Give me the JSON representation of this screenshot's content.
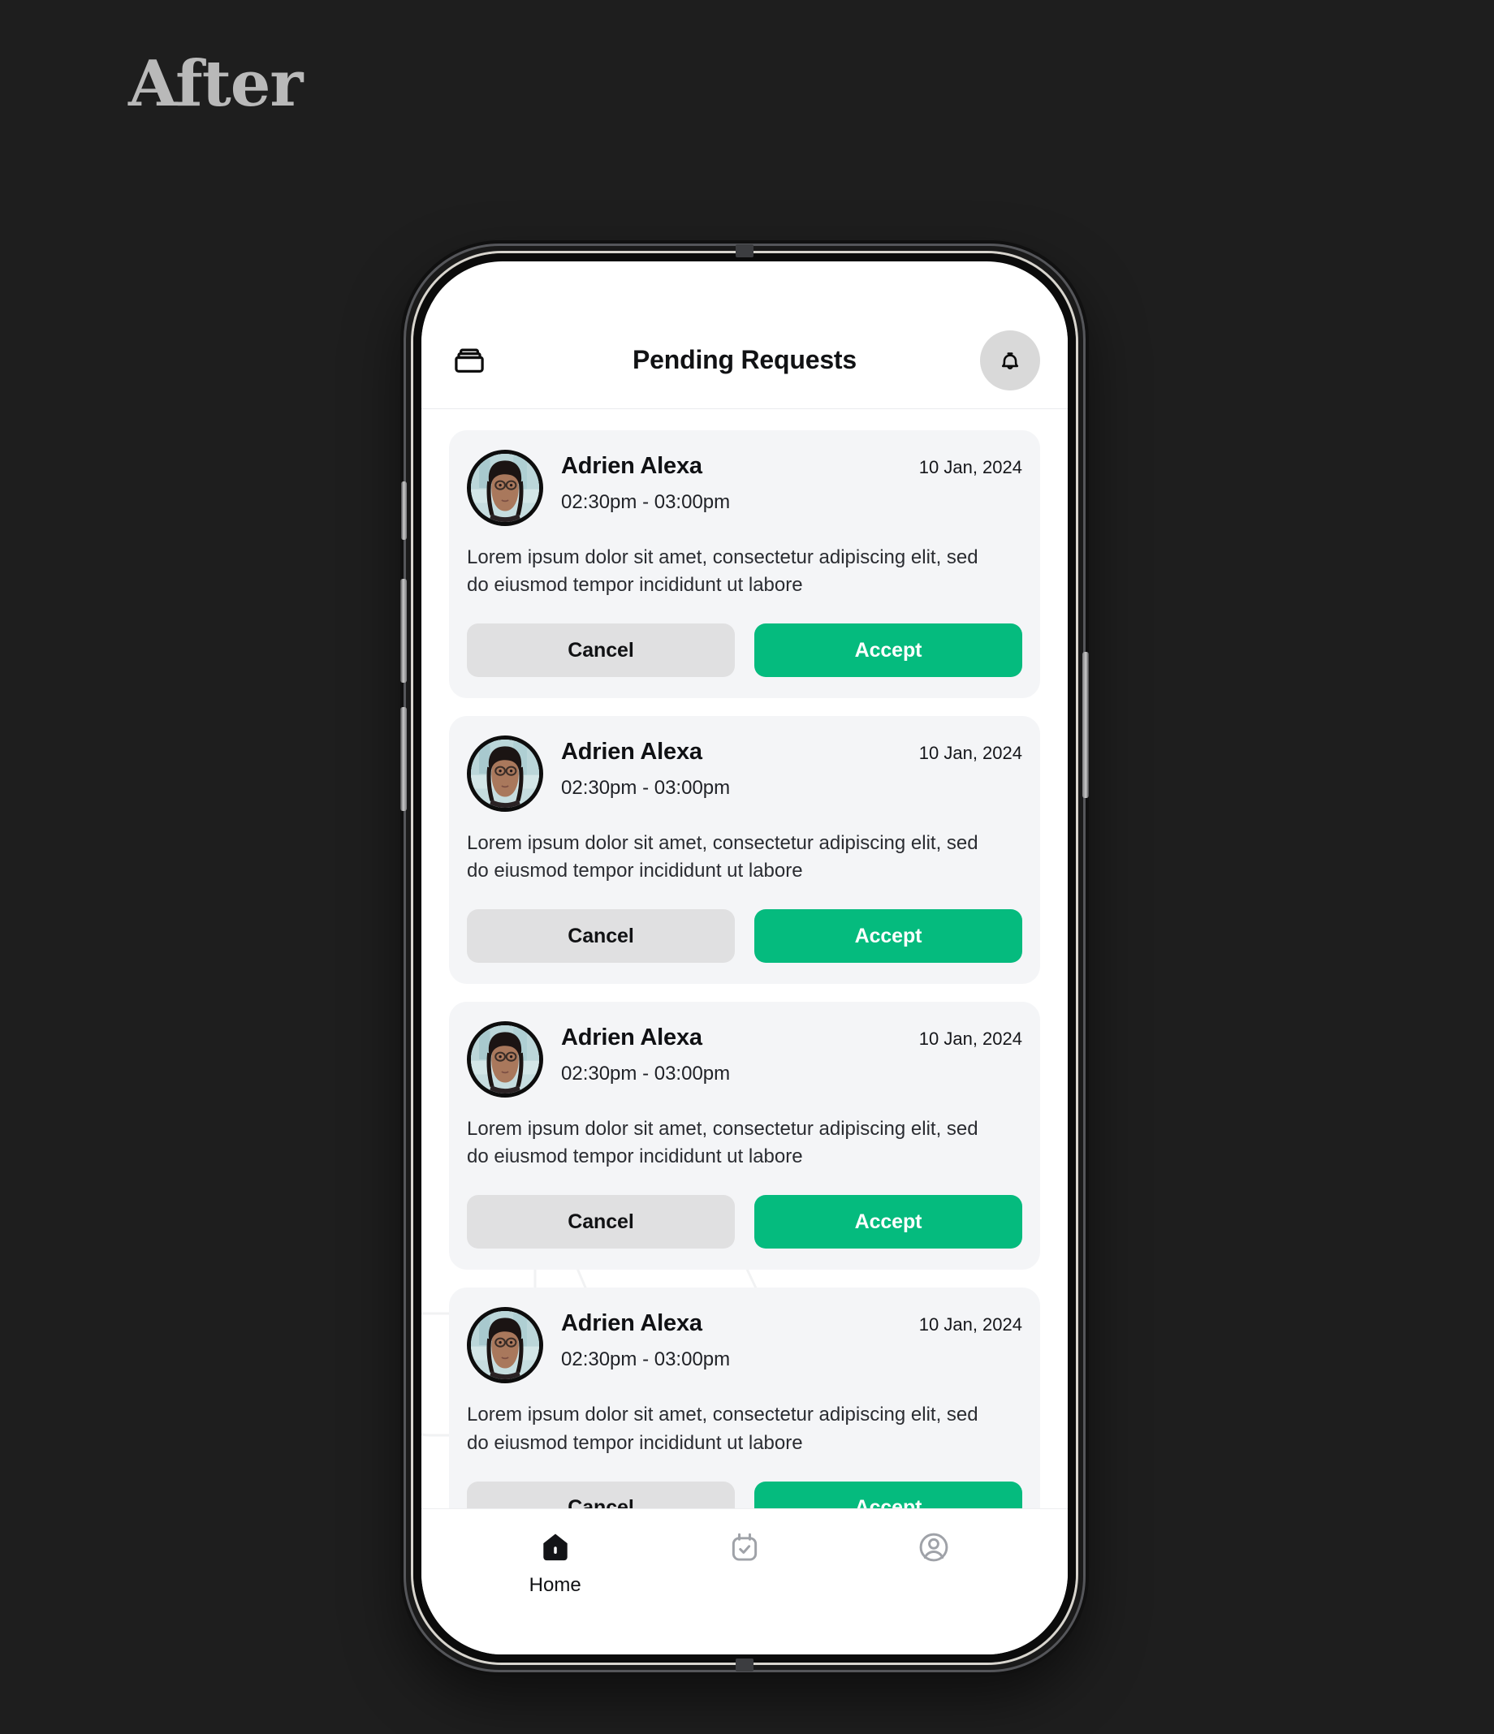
{
  "caption": "After",
  "header": {
    "logo_icon": "stacked-box-icon",
    "title": "Pending Requests",
    "bell_icon": "bell-icon"
  },
  "requests": [
    {
      "avatar_icon": "user-photo-avatar",
      "name": "Adrien Alexa",
      "date": "10 Jan, 2024",
      "time": "02:30pm -  03:00pm",
      "body": "Lorem ipsum dolor sit amet, consectetur adipiscing elit, sed do eiusmod tempor incididunt ut labore",
      "cancel_label": "Cancel",
      "accept_label": "Accept"
    },
    {
      "avatar_icon": "user-photo-avatar",
      "name": "Adrien Alexa",
      "date": "10 Jan, 2024",
      "time": "02:30pm -  03:00pm",
      "body": "Lorem ipsum dolor sit amet, consectetur adipiscing elit, sed do eiusmod tempor incididunt ut labore",
      "cancel_label": "Cancel",
      "accept_label": "Accept"
    },
    {
      "avatar_icon": "user-photo-avatar",
      "name": "Adrien Alexa",
      "date": "10 Jan, 2024",
      "time": "02:30pm -  03:00pm",
      "body": "Lorem ipsum dolor sit amet, consectetur adipiscing elit, sed do eiusmod tempor incididunt ut labore",
      "cancel_label": "Cancel",
      "accept_label": "Accept"
    },
    {
      "avatar_icon": "user-photo-avatar",
      "name": "Adrien Alexa",
      "date": "10 Jan, 2024",
      "time": "02:30pm -  03:00pm",
      "body": "Lorem ipsum dolor sit amet, consectetur adipiscing elit, sed do eiusmod tempor incididunt ut labore",
      "cancel_label": "Cancel",
      "accept_label": "Accept"
    }
  ],
  "bottom_nav": [
    {
      "icon": "home-icon",
      "label": "Home",
      "active": true
    },
    {
      "icon": "calendar-check-icon",
      "label": "",
      "active": false
    },
    {
      "icon": "user-circle-icon",
      "label": "",
      "active": false
    }
  ],
  "colors": {
    "accent_green": "#05BB7E",
    "cancel_gray": "#E0E0E1",
    "card_bg": "#F4F5F7",
    "page_bg": "#1E1E1E",
    "bell_bg": "#D9D9D9"
  }
}
